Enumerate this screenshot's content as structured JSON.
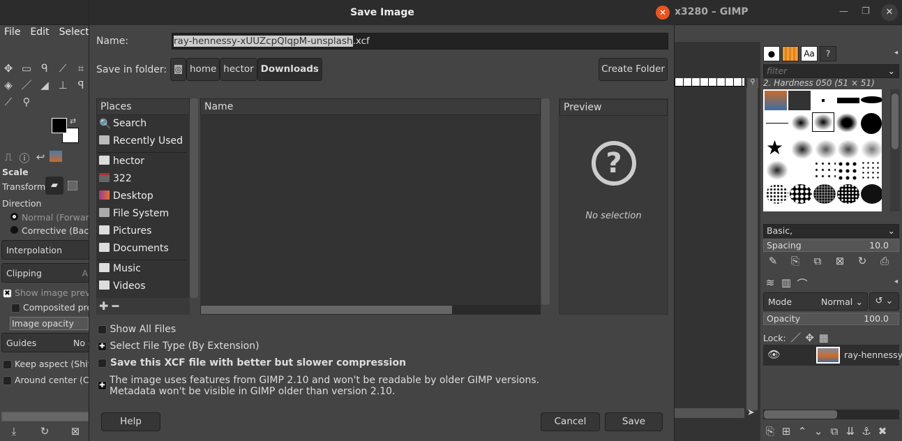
{
  "main_window": {
    "title_partial": "x3280 – GIMP",
    "menu": [
      "File",
      "Edit",
      "Select"
    ]
  },
  "tool_options": {
    "title": "Scale",
    "transform_label": "Transform:",
    "direction_label": "Direction",
    "direction_options": [
      "Normal (Forward)",
      "Corrective (Backward)"
    ],
    "interpolation": "Interpolation",
    "clipping": "Clipping",
    "clipping_value": "A",
    "show_preview": "Show image preview",
    "composited": "Composited preview",
    "image_opacity": "Image opacity",
    "guides": "Guides",
    "guides_value": "No guides",
    "keep_aspect": "Keep aspect (Shift)",
    "around_center": "Around center (Ctrl)"
  },
  "dialog": {
    "title": "Save Image",
    "name_label": "Name:",
    "name_selected": "ray-hennessy-xUUZcpQlqpM-unsplash",
    "name_ext": ".xcf",
    "folder_label": "Save in folder:",
    "path": [
      "home",
      "hector",
      "Downloads"
    ],
    "create_folder": "Create Folder",
    "places_header": "Places",
    "places": [
      {
        "label": "Search",
        "icon": "search-icon"
      },
      {
        "label": "Recently Used",
        "icon": "recent-icon"
      },
      {
        "label": "hector",
        "icon": "folder-icon"
      },
      {
        "label": "322",
        "icon": "drive-icon"
      },
      {
        "label": "Desktop",
        "icon": "desktop-icon"
      },
      {
        "label": "File System",
        "icon": "disk-icon"
      },
      {
        "label": "Pictures",
        "icon": "folder-icon"
      },
      {
        "label": "Documents",
        "icon": "folder-icon"
      },
      {
        "label": "Music",
        "icon": "folder-icon"
      },
      {
        "label": "Videos",
        "icon": "folder-icon"
      }
    ],
    "name_header": "Name",
    "preview_header": "Preview",
    "no_selection": "No selection",
    "show_all_files": "Show All Files",
    "select_file_type": "Select File Type (By Extension)",
    "compression": "Save this XCF file with better but slower compression",
    "info_line1": "The image uses features from GIMP 2.10 and won't be readable by older GIMP versions.",
    "info_line2": "Metadata won't be visible in GIMP older than version 2.10.",
    "help": "Help",
    "cancel": "Cancel",
    "save": "Save"
  },
  "brushes": {
    "filter_placeholder": "filter",
    "selected": "2. Hardness 050 (51 × 51)",
    "tag": "Basic,",
    "spacing_label": "Spacing",
    "spacing": "10.0"
  },
  "layers": {
    "mode_label": "Mode",
    "mode": "Normal",
    "opacity_label": "Opacity",
    "opacity": "100.0",
    "lock_label": "Lock:",
    "layer_name": "ray-hennessy-x"
  },
  "colors": {
    "accent_close": "#e9541f",
    "selection": "#cccccc"
  }
}
